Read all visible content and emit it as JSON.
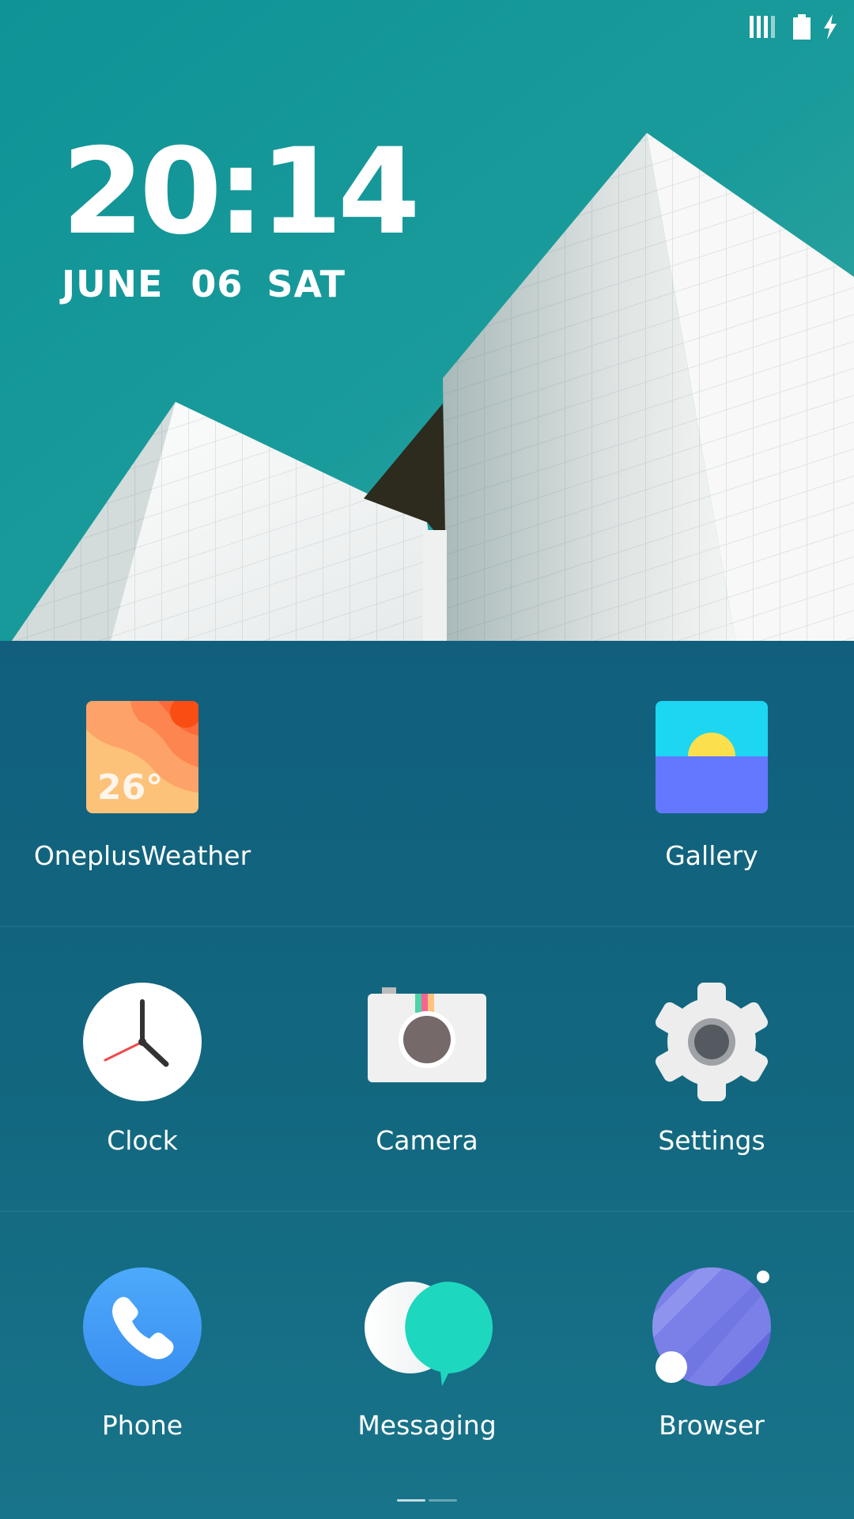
{
  "lock_widget": {
    "time": "20:14",
    "date": "JUNE 06",
    "weekday": "SAT"
  },
  "status_bar": {
    "icons": [
      "signal-icon",
      "battery-icon",
      "charging-bolt-icon"
    ]
  },
  "apps": {
    "row1": [
      {
        "label": "OneplusWeather",
        "icon": "weather-icon",
        "temp": "26°"
      },
      {
        "label": "Gallery",
        "icon": "gallery-icon"
      }
    ],
    "row2": [
      {
        "label": "Clock",
        "icon": "clock-icon"
      },
      {
        "label": "Camera",
        "icon": "camera-icon"
      },
      {
        "label": "Settings",
        "icon": "gear-icon"
      }
    ],
    "row3": [
      {
        "label": "Phone",
        "icon": "phone-icon"
      },
      {
        "label": "Messaging",
        "icon": "chat-bubble-icon"
      },
      {
        "label": "Browser",
        "icon": "planet-icon"
      }
    ]
  },
  "colors": {
    "sky": "#0f9497",
    "panel": "#156a84",
    "gallery_sky": "#1dd6f2",
    "gallery_sea": "#6378fe",
    "phone": "#3d99f5",
    "messaging": "#1dd8bf",
    "browser": "#7b80e8"
  }
}
